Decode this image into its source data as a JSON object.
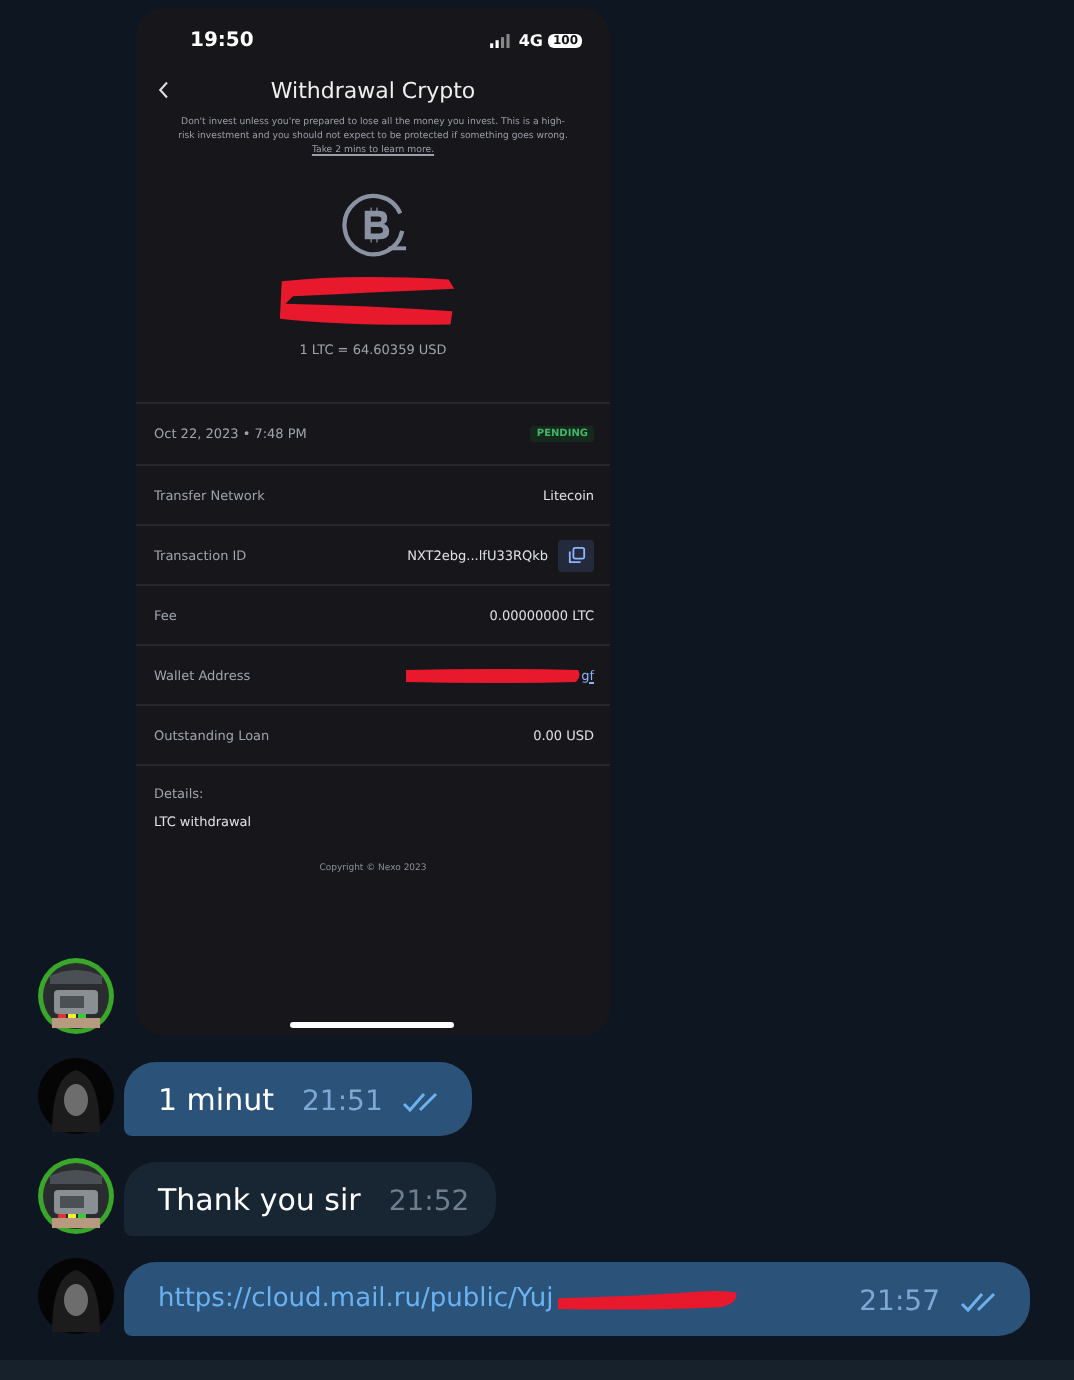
{
  "phone_screenshot": {
    "status_bar": {
      "time": "19:50",
      "network": "4G",
      "battery": "100"
    },
    "title": "Withdrawal Crypto",
    "disclaimer": "Don't invest unless you're prepared to lose all the money you invest. This is a high-risk investment and you should not expect to be protected if something goes wrong.",
    "disclaimer_link": "Take 2 mins to learn more.",
    "rate": "1 LTC = 64.60359  USD",
    "date": "Oct 22, 2023 • 7:48 PM",
    "status": "PENDING",
    "rows": [
      {
        "label": "Transfer Network",
        "value": "Litecoin",
        "kind": "text"
      },
      {
        "label": "Transaction ID",
        "value": "NXT2ebg...lfU33RQkb",
        "kind": "copy"
      },
      {
        "label": "Fee",
        "value": "0.00000000 LTC",
        "kind": "text"
      },
      {
        "label": "Wallet Address",
        "value": "gf",
        "kind": "redacted_link"
      },
      {
        "label": "Outstanding Loan",
        "value": "0.00  USD",
        "kind": "text"
      }
    ],
    "details_label": "Details:",
    "details": "LTC withdrawal",
    "copyright": "Copyright © Nexo 2023"
  },
  "messages": [
    {
      "outgoing": true,
      "kind": "text",
      "text": "1 minut",
      "time": "21:51",
      "read": true
    },
    {
      "outgoing": false,
      "kind": "text",
      "text": "Thank you sir",
      "time": "21:52",
      "read": false
    },
    {
      "outgoing": true,
      "kind": "link",
      "text": "https://cloud.mail.ru/public/Yuj",
      "time": "21:57",
      "read": true
    }
  ]
}
